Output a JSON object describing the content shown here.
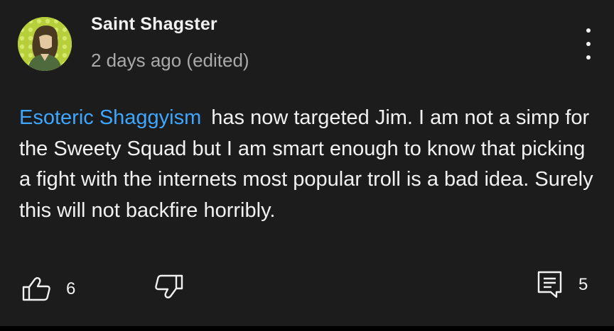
{
  "comment": {
    "author": "Saint Shagster",
    "timestamp": "2 days ago (edited)",
    "mention": "Esoteric Shaggyism",
    "text": "has now targeted Jim. I am not a simp for the Sweety Squad but I am smart enough to know that picking a fight with the internets most popular troll is a bad idea. Surely this will not backfire horribly.",
    "avatar_icon": "avatar-image",
    "more_icon": "more-vert-icon"
  },
  "actions": {
    "like_icon": "thumb-up-icon",
    "like_count": "6",
    "dislike_icon": "thumb-down-icon",
    "reply_icon": "comment-icon",
    "reply_count": "5"
  },
  "colors": {
    "background": "#1c1c1c",
    "text": "#f1f1f1",
    "secondary_text": "#aaaaaa",
    "mention": "#3ea6ff"
  }
}
